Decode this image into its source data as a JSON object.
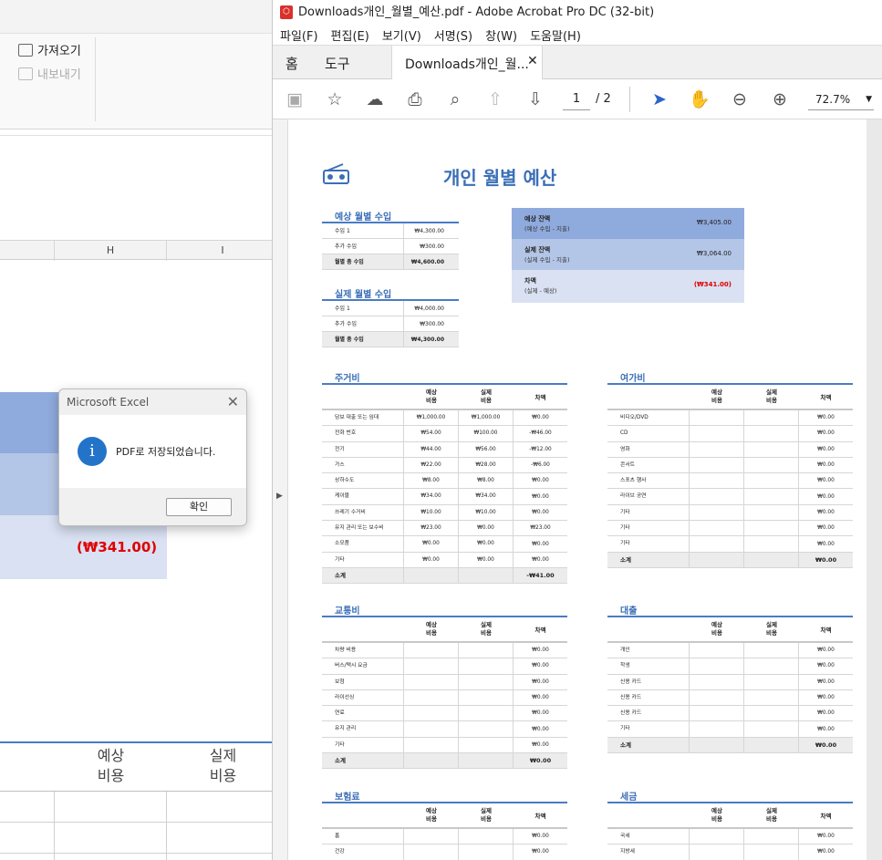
{
  "excel": {
    "ribbon": {
      "import_label": "가져오기",
      "export_label": "내보내기"
    },
    "columns": [
      "H",
      "I"
    ],
    "difference_value": "(₩341.00)",
    "header_planned": [
      "예상",
      "비용"
    ],
    "header_actual": [
      "실제",
      "비용"
    ],
    "dialog": {
      "title": "Microsoft Excel",
      "message": "PDF로 저장되었습니다.",
      "ok_label": "확인"
    }
  },
  "acrobat": {
    "window_title": "Downloads개인_월별_예산.pdf - Adobe Acrobat Pro DC (32-bit)",
    "menu": [
      "파일(F)",
      "편집(E)",
      "보기(V)",
      "서명(S)",
      "창(W)",
      "도움말(H)"
    ],
    "tabs": {
      "home": "홈",
      "tools": "도구",
      "document": "Downloads개인_월..."
    },
    "page_current": "1",
    "page_total": "/ 2",
    "zoom": "72.7%",
    "doc": {
      "title": "개인 월별 예산",
      "expected_income": {
        "title": "예상 월별 수입",
        "rows": [
          [
            "수입 1",
            "₩4,300.00"
          ],
          [
            "추가 수입",
            "₩300.00"
          ],
          [
            "월별 총 수입",
            "₩4,600.00"
          ]
        ]
      },
      "actual_income": {
        "title": "실제 월별 수입",
        "rows": [
          [
            "수입 1",
            "₩4,000.00"
          ],
          [
            "추가 수입",
            "₩300.00"
          ],
          [
            "월별 총 수입",
            "₩4,300.00"
          ]
        ]
      },
      "summary": [
        {
          "label": "예상 잔액",
          "sub": "(예상 수입 - 지출)",
          "value": "₩3,405.00"
        },
        {
          "label": "실제 잔액",
          "sub": "(실제 수입 - 지출)",
          "value": "₩3,064.00"
        },
        {
          "label": "차액",
          "sub": "(실제 - 예상)",
          "value": "(₩341.00)"
        }
      ],
      "col_planned": "예상\n비용",
      "col_actual": "실제\n비용",
      "col_diff": "차액",
      "housing": {
        "title": "주거비",
        "rows": [
          [
            "담보 대출 또는 임대",
            "₩1,000.00",
            "₩1,000.00",
            "₩0.00"
          ],
          [
            "전화 번호",
            "₩54.00",
            "₩100.00",
            "-₩46.00"
          ],
          [
            "전기",
            "₩44.00",
            "₩56.00",
            "-₩12.00"
          ],
          [
            "가스",
            "₩22.00",
            "₩28.00",
            "-₩6.00"
          ],
          [
            "상하수도",
            "₩8.00",
            "₩8.00",
            "₩0.00"
          ],
          [
            "케이블",
            "₩34.00",
            "₩34.00",
            "₩0.00"
          ],
          [
            "쓰레기 수거비",
            "₩10.00",
            "₩10.00",
            "₩0.00"
          ],
          [
            "유지 관리 또는 보수비",
            "₩23.00",
            "₩0.00",
            "₩23.00"
          ],
          [
            "소모품",
            "₩0.00",
            "₩0.00",
            "₩0.00"
          ],
          [
            "기타",
            "₩0.00",
            "₩0.00",
            "₩0.00"
          ]
        ],
        "total": [
          "소계",
          "",
          "",
          "-₩41.00"
        ]
      },
      "leisure": {
        "title": "여가비",
        "rows": [
          [
            "비디오/DVD",
            "",
            "",
            "₩0.00"
          ],
          [
            "CD",
            "",
            "",
            "₩0.00"
          ],
          [
            "영화",
            "",
            "",
            "₩0.00"
          ],
          [
            "콘서트",
            "",
            "",
            "₩0.00"
          ],
          [
            "스포츠 행사",
            "",
            "",
            "₩0.00"
          ],
          [
            "라이브 공연",
            "",
            "",
            "₩0.00"
          ],
          [
            "기타",
            "",
            "",
            "₩0.00"
          ],
          [
            "기타",
            "",
            "",
            "₩0.00"
          ],
          [
            "기타",
            "",
            "",
            "₩0.00"
          ]
        ],
        "total": [
          "소계",
          "",
          "",
          "₩0.00"
        ]
      },
      "transport": {
        "title": "교통비",
        "rows": [
          [
            "차량 비용",
            "",
            "",
            "₩0.00"
          ],
          [
            "버스/택시 요금",
            "",
            "",
            "₩0.00"
          ],
          [
            "보험",
            "",
            "",
            "₩0.00"
          ],
          [
            "라이선싱",
            "",
            "",
            "₩0.00"
          ],
          [
            "연료",
            "",
            "",
            "₩0.00"
          ],
          [
            "유지 관리",
            "",
            "",
            "₩0.00"
          ],
          [
            "기타",
            "",
            "",
            "₩0.00"
          ]
        ],
        "total": [
          "소계",
          "",
          "",
          "₩0.00"
        ]
      },
      "loans": {
        "title": "대출",
        "rows": [
          [
            "개인",
            "",
            "",
            "₩0.00"
          ],
          [
            "학생",
            "",
            "",
            "₩0.00"
          ],
          [
            "신용 카드",
            "",
            "",
            "₩0.00"
          ],
          [
            "신용 카드",
            "",
            "",
            "₩0.00"
          ],
          [
            "신용 카드",
            "",
            "",
            "₩0.00"
          ],
          [
            "기타",
            "",
            "",
            "₩0.00"
          ]
        ],
        "total": [
          "소계",
          "",
          "",
          "₩0.00"
        ]
      },
      "insurance": {
        "title": "보험료",
        "rows": [
          [
            "홈",
            "",
            "",
            "₩0.00"
          ],
          [
            "건강",
            "",
            "",
            "₩0.00"
          ]
        ]
      },
      "taxes": {
        "title": "세금",
        "rows": [
          [
            "국세",
            "",
            "",
            "₩0.00"
          ],
          [
            "지방세",
            "",
            "",
            "₩0.00"
          ]
        ]
      }
    }
  },
  "colors": {
    "accent": "#3b6fb6",
    "band1": "#8faadc",
    "band2": "#b4c6e7",
    "band3": "#d9e1f2",
    "negative": "#e00000"
  }
}
